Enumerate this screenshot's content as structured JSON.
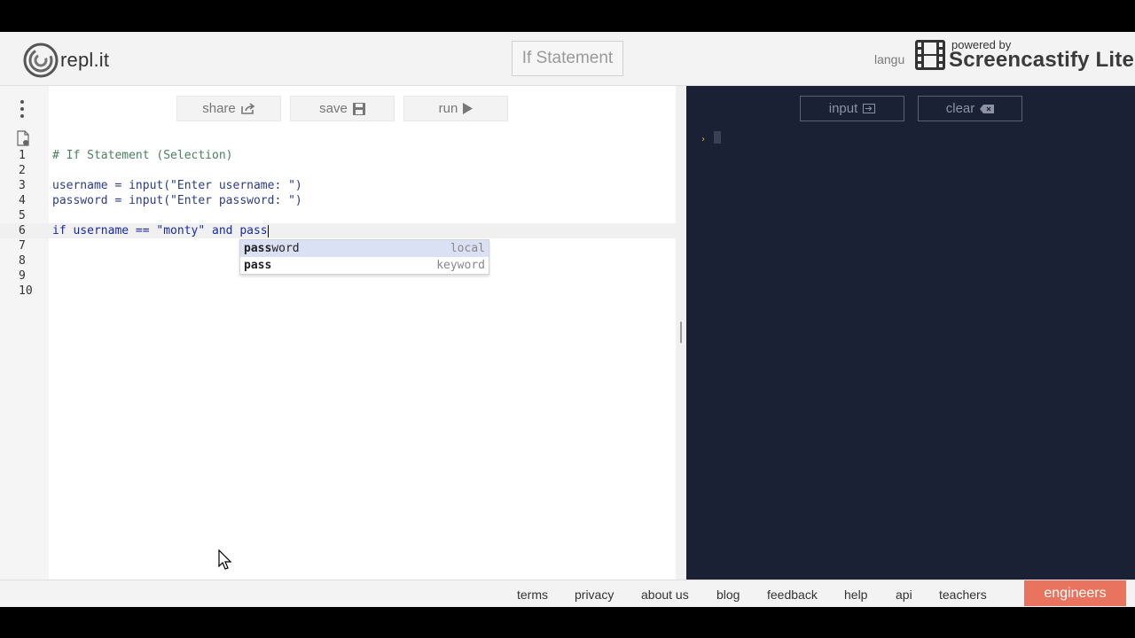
{
  "header": {
    "logo_text": "repl.it",
    "title": "If Statement",
    "language_partial": "langu",
    "watermark_small": "powered by",
    "watermark_big": "Screencastify Lite"
  },
  "toolbar": {
    "share_label": "share",
    "save_label": "save",
    "run_label": "run"
  },
  "editor": {
    "line_numbers": [
      "1",
      "2",
      "3",
      "4",
      "5",
      "6",
      "7",
      "8",
      "9",
      "10"
    ],
    "active_line": 6,
    "lines": [
      "# If Statement (Selection)",
      "",
      "username = input(\"Enter username: \")",
      "password = input(\"Enter password: \")",
      "",
      "if username == \"monty\" and pass",
      "",
      "",
      "",
      ""
    ],
    "autocomplete": [
      {
        "text_match": "pass",
        "text_rest": "word",
        "type": "local",
        "selected": true
      },
      {
        "text_match": "pass",
        "text_rest": "",
        "type": "keyword",
        "selected": false
      }
    ]
  },
  "console": {
    "input_label": "input",
    "clear_label": "clear",
    "prompt_symbol": "›"
  },
  "footer": {
    "links": [
      "terms",
      "privacy",
      "about us",
      "blog",
      "feedback",
      "help",
      "api",
      "teachers"
    ],
    "engineers_label": "engineers"
  },
  "colors": {
    "console_bg": "#1b2134",
    "accent_orange": "#e8735f",
    "prompt_yellow": "#d7b63e",
    "autocomplete_highlight": "#dae1f5"
  }
}
